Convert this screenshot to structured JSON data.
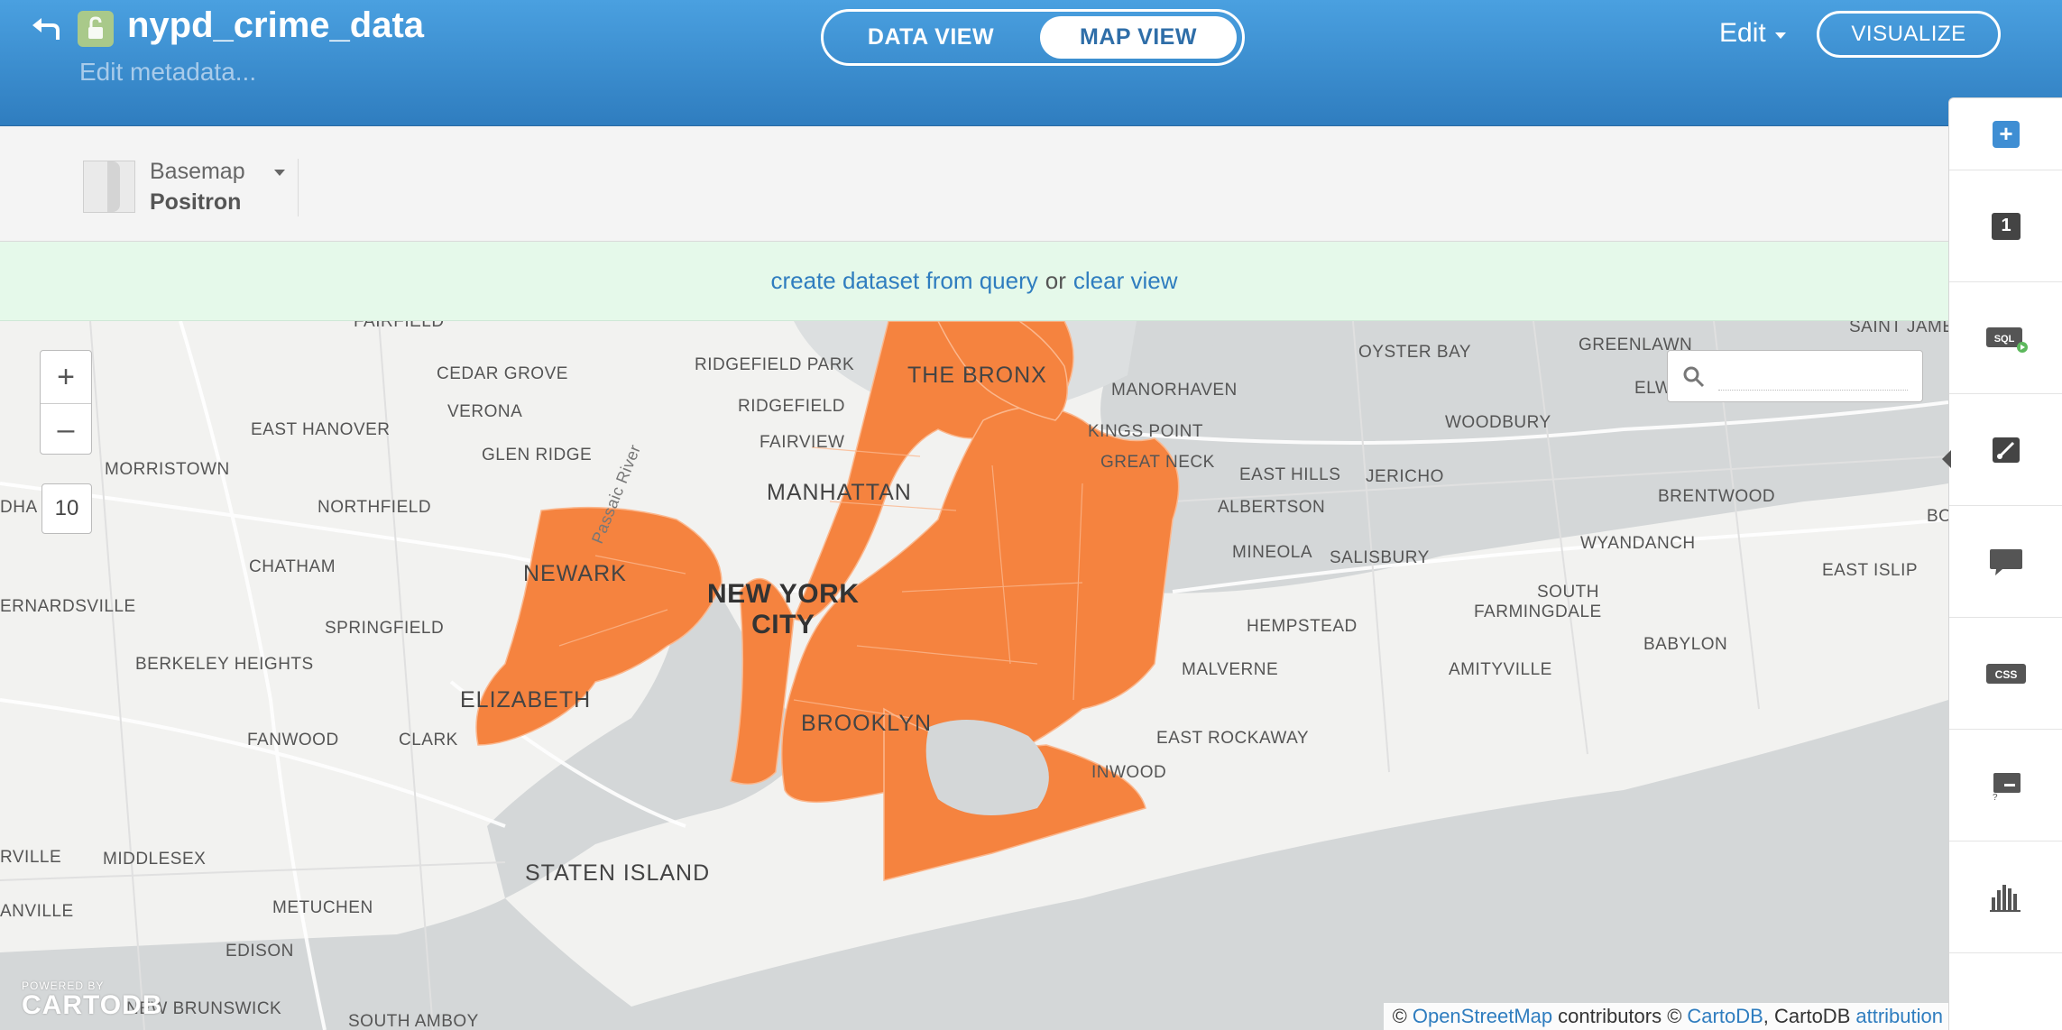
{
  "header": {
    "title": "nypd_crime_data",
    "metadata_link": "Edit metadata...",
    "view_toggle": {
      "data_view": "DATA VIEW",
      "map_view": "MAP VIEW",
      "active": "MAP VIEW"
    },
    "edit_menu": "Edit",
    "visualize_button": "VISUALIZE"
  },
  "toolbar": {
    "basemap_label": "Basemap",
    "basemap_value": "Positron"
  },
  "query_bar": {
    "create_link": "create dataset from query",
    "or_text": "or",
    "clear_link": "clear view"
  },
  "map": {
    "zoom_in": "+",
    "zoom_out": "–",
    "zoom_level": "10",
    "highlight_color": "#f5833f",
    "places": {
      "fairfield": "FAIRFIELD",
      "ridgefield_park": "RIDGEFIELD PARK",
      "the_bronx": "THE BRONX",
      "oyster_bay": "OYSTER BAY",
      "greenlawn": "GREENLAWN",
      "saint_james": "SAINT JAMES",
      "cedar_grove": "CEDAR GROVE",
      "ridgefield": "RIDGEFIELD",
      "manorhaven": "MANORHAVEN",
      "elw": "ELW",
      "verona": "VERONA",
      "east_hanover": "EAST HANOVER",
      "fairview": "FAIRVIEW",
      "kings_point": "KINGS POINT",
      "woodbury": "WOODBURY",
      "glen_ridge": "GLEN RIDGE",
      "passaic_river": "Passaic River",
      "great_neck": "GREAT NECK",
      "morristown": "MORRISTOWN",
      "east_hills": "EAST HILLS",
      "jericho": "JERICHO",
      "manhattan": "MANHATTAN",
      "brentwood": "BRENTWOOD",
      "dha": "DHA",
      "northfield": "NORTHFIELD",
      "albertson": "ALBERTSON",
      "bo": "BO",
      "wyandanch": "WYANDANCH",
      "mineola": "MINEOLA",
      "salisbury": "SALISBURY",
      "chatham": "CHATHAM",
      "newark": "NEWARK",
      "east_islip": "EAST ISLIP",
      "new_york_city": "NEW YORK\nCITY",
      "south": "SOUTH",
      "farmingdale": "FARMINGDALE",
      "bernardsville": "ERNARDSVILLE",
      "springfield": "SPRINGFIELD",
      "hempstead": "HEMPSTEAD",
      "babylon": "BABYLON",
      "berkeley_heights": "BERKELEY HEIGHTS",
      "malverne": "MALVERNE",
      "amityville": "AMITYVILLE",
      "elizabeth": "ELIZABETH",
      "brooklyn": "BROOKLYN",
      "fanwood": "FANWOOD",
      "clark": "CLARK",
      "east_rockaway": "EAST ROCKAWAY",
      "inwood": "INWOOD",
      "rville": "RVILLE",
      "middlesex": "MIDDLESEX",
      "staten_island": "STATEN ISLAND",
      "anville": "ANVILLE",
      "metuchen": "METUCHEN",
      "edison": "EDISON",
      "new_brunswick": "NEW BRUNSWICK",
      "south_amboy": "SOUTH AMBOY"
    },
    "logo": {
      "powered_by": "POWERED BY",
      "brand": "CARTODB"
    },
    "attribution": {
      "copyright": "©",
      "osm_link": "OpenStreetMap",
      "contributors": "contributors ©",
      "cartodb_link": "CartoDB",
      "cartodb_text": ", CartoDB",
      "attribution_link": "attribution"
    }
  },
  "right_panel": {
    "add_layer": "+",
    "layer_number": "1",
    "tools": [
      "sql-icon",
      "wizard-icon",
      "infowindow-icon",
      "css-icon",
      "legend-icon",
      "filters-icon"
    ]
  }
}
